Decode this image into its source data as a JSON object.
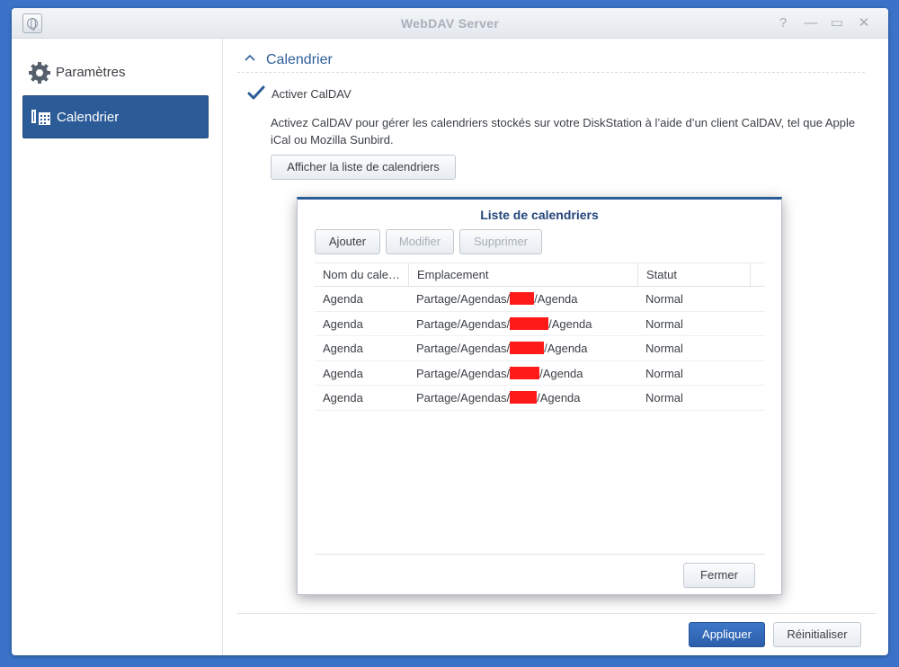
{
  "window": {
    "title": "WebDAV Server",
    "controls": [
      "?",
      "—",
      "▭",
      "✕"
    ]
  },
  "sidebar": {
    "items": [
      {
        "label": "Paramètres",
        "icon": "gear-icon",
        "active": false
      },
      {
        "label": "Calendrier",
        "icon": "calendar-icon",
        "active": true
      }
    ]
  },
  "section": {
    "title": "Calendrier",
    "caldav_checkbox": {
      "label": "Activer CalDAV",
      "checked": true
    },
    "description": "Activez CalDAV pour gérer les calendriers stockés sur votre DiskStation à l’aide d’un client CalDAV, tel que Apple iCal ou Mozilla Sunbird.",
    "show_list_button": "Afficher la liste de calendriers"
  },
  "dialog": {
    "title": "Liste de calendriers",
    "toolbar": {
      "add": "Ajouter",
      "edit": "Modifier",
      "delete": "Supprimer"
    },
    "columns": [
      "Nom du cale…",
      "Emplacement",
      "Statut"
    ],
    "rows": [
      {
        "name": "Agenda",
        "location_prefix": "Partage/Agendas/",
        "location_suffix": "/Agenda",
        "status": "Normal"
      },
      {
        "name": "Agenda",
        "location_prefix": "Partage/Agendas/",
        "location_suffix": "/Agenda",
        "status": "Normal"
      },
      {
        "name": "Agenda",
        "location_prefix": "Partage/Agendas/",
        "location_suffix": "/Agenda",
        "status": "Normal"
      },
      {
        "name": "Agenda",
        "location_prefix": "Partage/Agendas/",
        "location_suffix": "/Agenda",
        "status": "Normal"
      },
      {
        "name": "Agenda",
        "location_prefix": "Partage/Agendas/",
        "location_suffix": "/Agenda",
        "status": "Normal"
      }
    ],
    "close_button": "Fermer"
  },
  "footer": {
    "apply": "Appliquer",
    "reset": "Réinitialiser"
  },
  "colors": {
    "accent": "#2c5c98",
    "desktop": "#3a73c8",
    "redaction": "#ff1a1a"
  }
}
